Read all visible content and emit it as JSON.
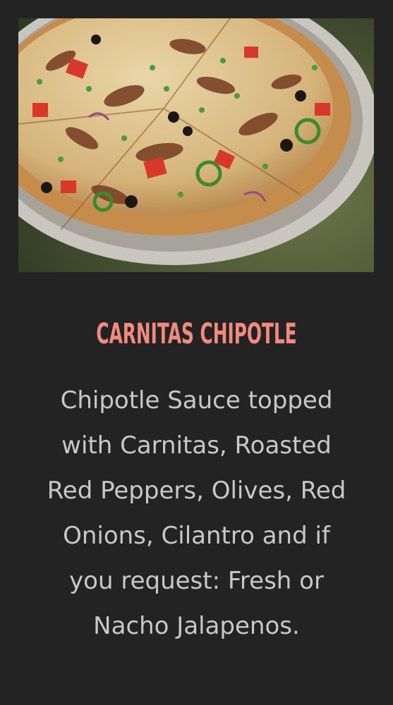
{
  "menu_item": {
    "image_alt": "Carnitas Chipotle pizza",
    "title": "CARNITAS CHIPOTLE",
    "description": "Chipotle Sauce topped with Carnitas, Roasted Red Peppers, Olives, Red Onions, Cilantro and if you request: Fresh or Nacho Jalapenos."
  },
  "colors": {
    "background": "#232323",
    "title": "#f18a7f",
    "description": "#c8c8c8"
  }
}
